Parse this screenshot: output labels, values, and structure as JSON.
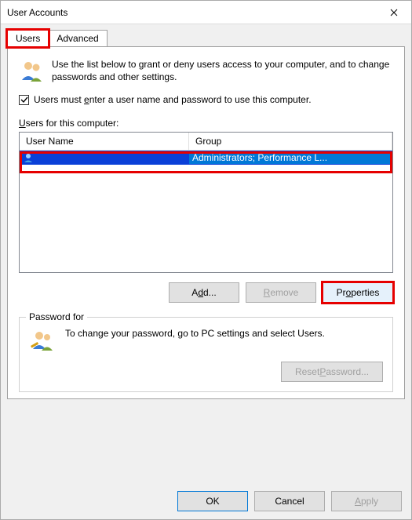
{
  "window": {
    "title": "User Accounts"
  },
  "tabs": {
    "users": "Users",
    "advanced": "Advanced"
  },
  "intro": "Use the list below to grant or deny users access to your computer, and to change passwords and other settings.",
  "checkbox": {
    "checked": true,
    "label_pre": "Users must ",
    "label_u": "e",
    "label_rest": "nter a user name and password to use this computer."
  },
  "list": {
    "label_u": "U",
    "label_rest": "sers for this computer:",
    "col_name": "User Name",
    "col_group": "Group",
    "rows": [
      {
        "name": "",
        "group": "Administrators; Performance L..."
      }
    ]
  },
  "buttons": {
    "add_pre": "A",
    "add_u": "d",
    "add_post": "d...",
    "remove_u": "R",
    "remove_rest": "emove",
    "properties_pre": "Pr",
    "properties_u": "o",
    "properties_post": "perties"
  },
  "password_group": {
    "label": "Password for ",
    "text": "To change your password, go to PC settings and select Users.",
    "reset_pre": "Reset ",
    "reset_u": "P",
    "reset_post": "assword..."
  },
  "dlg": {
    "ok": "OK",
    "cancel": "Cancel",
    "apply_u": "A",
    "apply_rest": "pply"
  }
}
